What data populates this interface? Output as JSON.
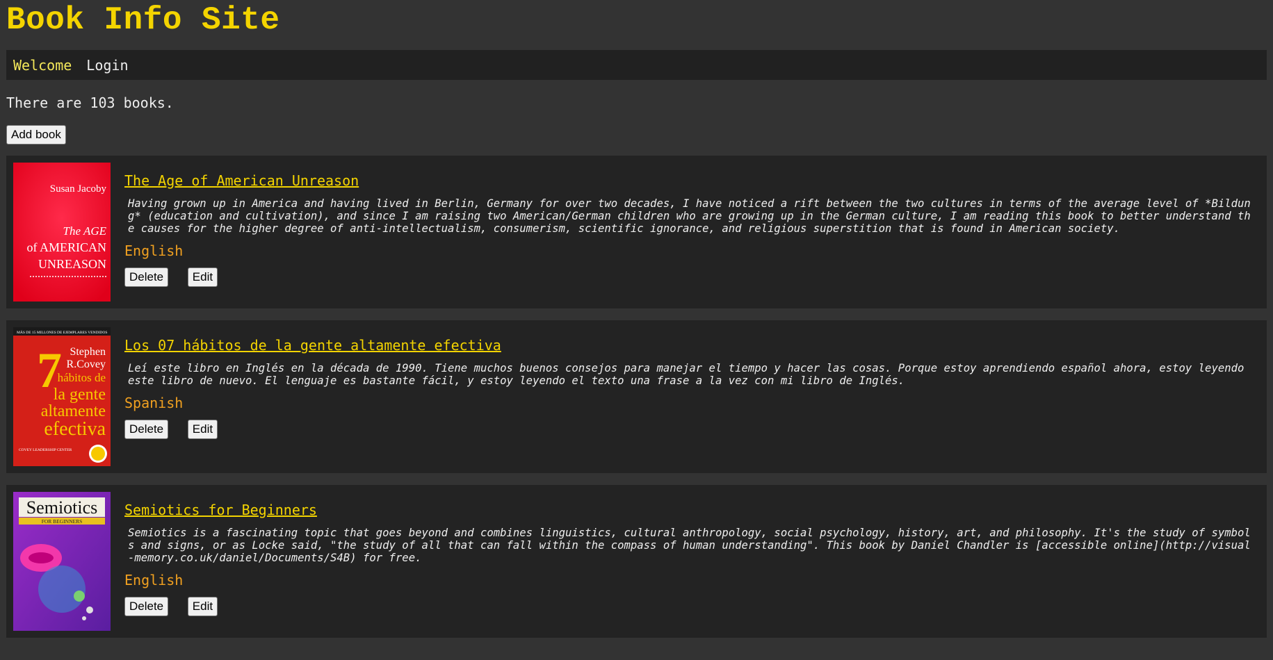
{
  "site": {
    "title": "Book Info Site"
  },
  "nav": {
    "welcome": "Welcome",
    "login": "Login"
  },
  "summary": {
    "count_text": "There are 103 books."
  },
  "actions": {
    "add_book": "Add book"
  },
  "books": [
    {
      "title": "The Age of American Unreason",
      "description": "Having grown up in America and having lived in Berlin, Germany for over two decades, I have noticed a rift between the two cultures in terms of the average level of *Bildung* (education and cultivation), and since I am raising two American/German children who are growing up in the German culture, I am reading this book to better understand the causes for the higher degree of anti-intellectualism, consumerism, scientific ignorance, and religious superstition that is found in American society.",
      "language": "English",
      "delete_label": "Delete",
      "edit_label": "Edit",
      "cover": {
        "author": "Susan Jacoby",
        "line1": "The AGE",
        "line2": "of AMERICAN",
        "line3": "UNREASON"
      }
    },
    {
      "title": "Los 07 hábitos de la gente altamente efectiva",
      "description": "Leí este libro en Inglés en la década de 1990. Tiene muchos buenos consejos para manejar el tiempo y hacer las cosas. Porque estoy aprendiendo español ahora, estoy leyendo este libro de nuevo. El lenguaje es bastante fácil, y estoy leyendo el texto una frase a la vez con mi libro de Inglés.",
      "language": "Spanish",
      "delete_label": "Delete",
      "edit_label": "Edit",
      "cover": {
        "top": "MÁS DE 15 MILLONES DE EJEMPLARES VENDIDOS",
        "author1": "Stephen",
        "author2": "R.Covey",
        "number": "7",
        "line1": "hábitos de",
        "line2": "la gente",
        "line3": "altamente",
        "line4": "efectiva",
        "bottom": "COVEY LEADERSHIP CENTER"
      }
    },
    {
      "title": "Semiotics for Beginners",
      "description": "Semiotics is a fascinating topic that goes beyond and combines linguistics, cultural anthropology, social psychology, history, art, and philosophy. It's the study of symbols and signs, or as Locke said, \"the study of all that can fall within the compass of human understanding\". This book by Daniel Chandler is [accessible online](http://visual-memory.co.uk/daniel/Documents/S4B) for free.",
      "language": "English",
      "delete_label": "Delete",
      "edit_label": "Edit",
      "cover": {
        "title": "Semiotics",
        "subtitle": "FOR BEGINNERS"
      }
    }
  ],
  "colors": {
    "background": "#333333",
    "card": "#232323",
    "title_yellow": "#f4d400",
    "language_orange": "#f0a020"
  }
}
